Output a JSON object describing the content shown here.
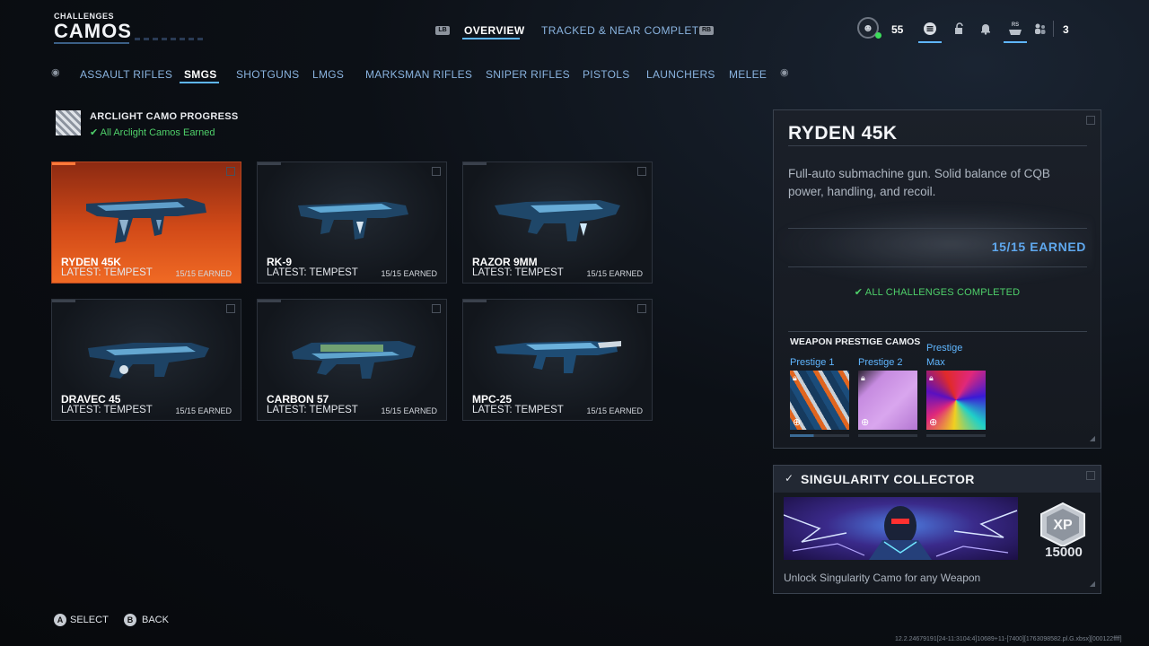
{
  "header": {
    "section": "CHALLENGES",
    "title": "CAMOS",
    "left_bumper": "LB",
    "right_bumper": "RB",
    "tabs": [
      {
        "label": "OVERVIEW",
        "active": true
      },
      {
        "label": "TRACKED & NEAR COMPLETE",
        "active": false
      }
    ]
  },
  "player": {
    "level": "55",
    "notifications_count": "3",
    "icons": [
      "player-emblem-icon",
      "menu-icon",
      "lock-icon",
      "bell-icon",
      "rs-controller-icon",
      "friends-icon"
    ],
    "rs_label": "RS"
  },
  "categories": [
    {
      "label": "ASSAULT RIFLES",
      "active": false
    },
    {
      "label": "SMGS",
      "active": true
    },
    {
      "label": "SHOTGUNS",
      "active": false
    },
    {
      "label": "LMGS",
      "active": false
    },
    {
      "label": "MARKSMAN RIFLES",
      "active": false
    },
    {
      "label": "SNIPER RIFLES",
      "active": false
    },
    {
      "label": "PISTOLS",
      "active": false
    },
    {
      "label": "LAUNCHERS",
      "active": false
    },
    {
      "label": "MELEE",
      "active": false
    }
  ],
  "arclight": {
    "title": "ARCLIGHT CAMO PROGRESS",
    "status": "All Arclight Camos Earned"
  },
  "weapons": [
    {
      "name": "RYDEN 45K",
      "latest": "LATEST: TEMPEST",
      "earned": "15/15 EARNED",
      "selected": true
    },
    {
      "name": "RK-9",
      "latest": "LATEST: TEMPEST",
      "earned": "15/15 EARNED",
      "selected": false
    },
    {
      "name": "RAZOR 9MM",
      "latest": "LATEST: TEMPEST",
      "earned": "15/15 EARNED",
      "selected": false
    },
    {
      "name": "DRAVEC 45",
      "latest": "LATEST: TEMPEST",
      "earned": "15/15 EARNED",
      "selected": false
    },
    {
      "name": "CARBON 57",
      "latest": "LATEST: TEMPEST",
      "earned": "15/15 EARNED",
      "selected": false
    },
    {
      "name": "MPC-25",
      "latest": "LATEST: TEMPEST",
      "earned": "15/15 EARNED",
      "selected": false
    }
  ],
  "detail": {
    "title": "RYDEN 45K",
    "description": "Full-auto submachine gun. Solid balance of CQB power, handling, and recoil.",
    "earned": "15/15 EARNED",
    "status": "ALL CHALLENGES COMPLETED",
    "prestige_heading": "WEAPON PRESTIGE CAMOS",
    "prestige": [
      {
        "label": "Prestige 1"
      },
      {
        "label": "Prestige 2"
      },
      {
        "label": "Prestige Max"
      }
    ]
  },
  "challenge": {
    "title": "SINGULARITY COLLECTOR",
    "reward_badge": "XP",
    "xp": "15000",
    "description": "Unlock Singularity Camo for any Weapon"
  },
  "footer": {
    "select_key": "A",
    "select_label": "SELECT",
    "back_key": "B",
    "back_label": "BACK",
    "build": "12.2.24679191[24-11:3104:4]10689+11-[7400][1763098582.pl.G.xbsx][000122ffff]"
  },
  "colors": {
    "accent": "#5fb6ff",
    "selected_card": "#e05a1e",
    "success": "#4fd06a"
  }
}
